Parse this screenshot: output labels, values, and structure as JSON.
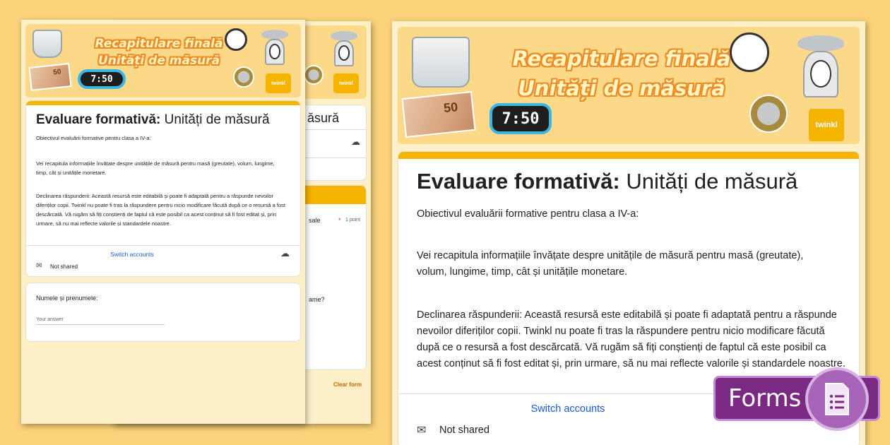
{
  "banner": {
    "title_line1": "Recapitulare finală",
    "title_line2": "Unități de măsură",
    "clock_digital": "7:50",
    "banknote_value": "50",
    "brand": "twinkl"
  },
  "form": {
    "title_bold": "Evaluare formativă:",
    "title_rest": " Unități de măsură",
    "objective": "Obiectivul evaluării formative pentru clasa a IV-a:",
    "intro": "Vei recapitula informațiile învățate despre unitățile de măsură pentru masă (greutate), volum, lungime, timp, cât și unitățile monetare.",
    "disclaimer": "Declinarea răspunderii: Această resursă este editabilă și poate fi adaptată pentru a răspunde nevoilor diferiților copii. Twinkl nu poate fi tras la răspundere pentru nicio modificare făcută după ce o resursă a fost descărcată. Vă rugăm să fiți conștienți de faptul că este posibil ca acest conținut să fi fost editat și, prin urmare, să nu mai reflecte valorile și standardele noastre.",
    "switch_accounts": "Switch accounts",
    "not_shared": "Not shared",
    "question_label": "Numele și prenumele:",
    "answer_placeholder": "Your answer"
  },
  "back_page": {
    "title_fragment": "ăsură",
    "question_fragment": "sale",
    "required_mark": "*",
    "points": "1 point",
    "question2_fragment": "ame?",
    "clear_form": "Clear form"
  },
  "badge": {
    "label": "Forms"
  },
  "colors": {
    "background": "#fbd27a",
    "accent": "#f5b400",
    "link": "#1a57d6",
    "badge": "#7a2a82"
  }
}
